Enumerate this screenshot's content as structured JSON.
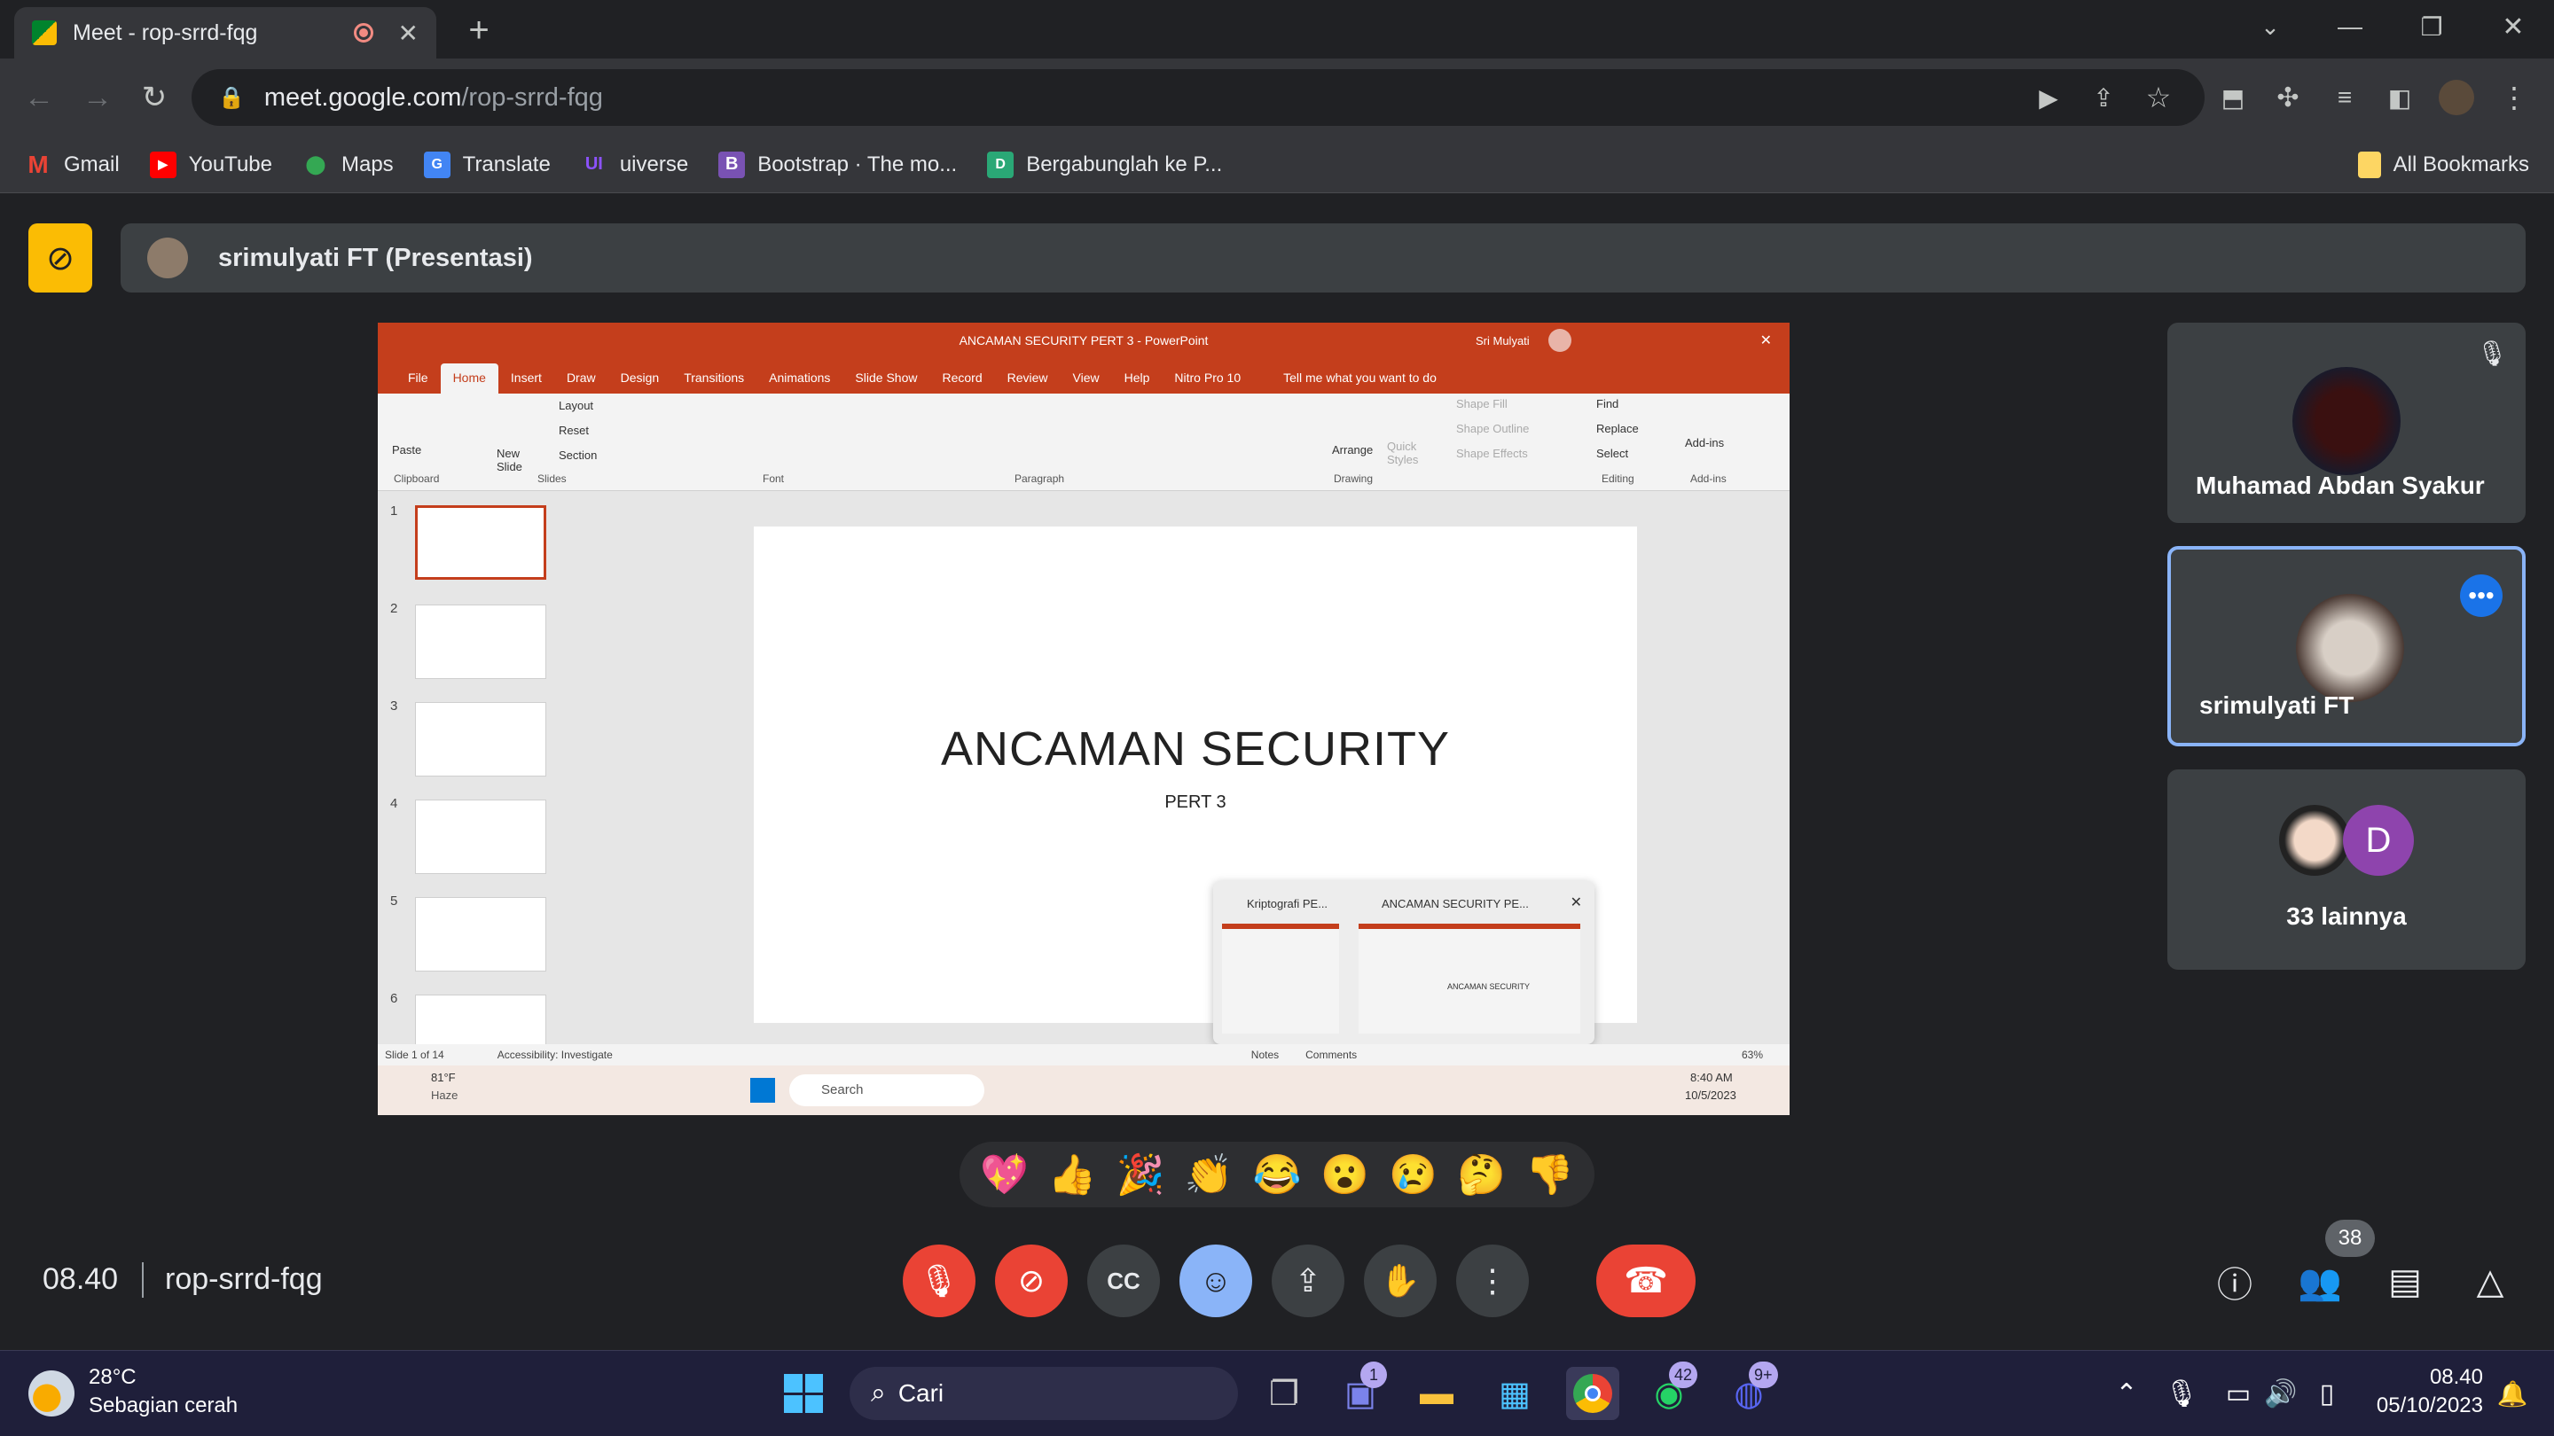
{
  "browser": {
    "tab_title": "Meet - rop-srrd-fqg",
    "url_host": "meet.google.com",
    "url_path": "/rop-srrd-fqg",
    "bookmarks": [
      "Gmail",
      "YouTube",
      "Maps",
      "Translate",
      "uiverse",
      "Bootstrap · The mo...",
      "Bergabunglah ke P..."
    ],
    "all_bookmarks": "All Bookmarks"
  },
  "meet": {
    "presenting_label": "srimulyati FT (Presentasi)",
    "clock": "08.40",
    "meeting_code": "rop-srrd-fqg",
    "participant_count": "38",
    "participants": [
      {
        "name": "Muhamad Abdan Syakur",
        "muted": true
      },
      {
        "name": "srimulyati FT",
        "active": true
      },
      {
        "name": "33 lainnya",
        "avatar_letter": "D"
      }
    ],
    "reactions": [
      "💖",
      "👍",
      "🎉",
      "👏",
      "😂",
      "😮",
      "😢",
      "🤔",
      "👎"
    ]
  },
  "shared_screen": {
    "ppt_title": "ANCAMAN SECURITY PERT 3 - PowerPoint",
    "ppt_user": "Sri Mulyati",
    "ribbon_tabs": [
      "File",
      "Home",
      "Insert",
      "Draw",
      "Design",
      "Transitions",
      "Animations",
      "Slide Show",
      "Record",
      "Review",
      "View",
      "Help",
      "Nitro Pro 10"
    ],
    "tell_me": "Tell me what you want to do",
    "ribbon_groups": [
      "Clipboard",
      "Slides",
      "Font",
      "Paragraph",
      "Drawing",
      "Editing",
      "Add-ins"
    ],
    "ribbon_buttons": {
      "paste": "Paste",
      "new_slide": "New Slide",
      "layout": "Layout",
      "reset": "Reset",
      "section": "Section",
      "arrange": "Arrange",
      "quick_styles": "Quick Styles",
      "shape_fill": "Shape Fill",
      "shape_outline": "Shape Outline",
      "shape_effects": "Shape Effects",
      "find": "Find",
      "replace": "Replace",
      "select": "Select",
      "add_ins": "Add-ins"
    },
    "slide_numbers": [
      "1",
      "2",
      "3",
      "4",
      "5",
      "6"
    ],
    "slide_title": "ANCAMAN SECURITY",
    "slide_subtitle": "PERT 3",
    "status_slide": "Slide 1 of 14",
    "status_accessibility": "Accessibility: Investigate",
    "status_notes": "Notes",
    "status_comments": "Comments",
    "zoom": "63%",
    "popup_items": [
      "Kriptografi PE...",
      "ANCAMAN SECURITY PE..."
    ],
    "popup_thumb_text": "ANCAMAN SECURITY",
    "remote_weather_temp": "81°F",
    "remote_weather_desc": "Haze",
    "remote_search": "Search",
    "remote_time": "8:40 AM",
    "remote_date": "10/5/2023"
  },
  "taskbar": {
    "weather_temp": "28°C",
    "weather_desc": "Sebagian cerah",
    "search": "Cari",
    "badges": {
      "teams": "1",
      "whatsapp": "42",
      "discord": "9+"
    },
    "time": "08.40",
    "date": "05/10/2023"
  },
  "colors": {
    "ppt_accent": "#c43e1c",
    "meet_red": "#ea4335",
    "meet_blue": "#8ab4f8",
    "present_yellow": "#fbbc04"
  }
}
